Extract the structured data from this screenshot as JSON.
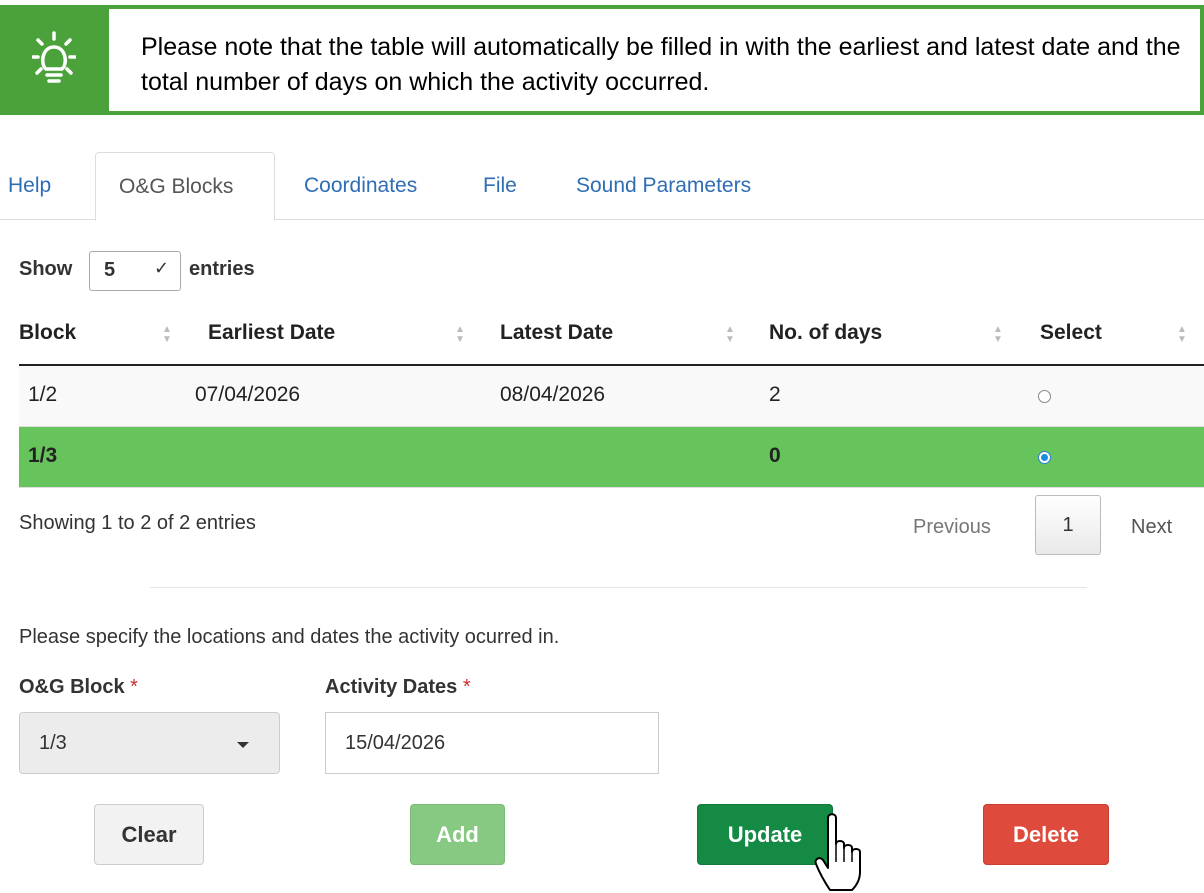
{
  "note": {
    "icon": "lightbulb-icon",
    "text": "Please note that the table will automatically be filled in with the earliest and latest date and the total number of days on which the activity occurred."
  },
  "tabs": [
    {
      "label": "Help",
      "active": false
    },
    {
      "label": "O&G Blocks",
      "active": true
    },
    {
      "label": "Coordinates",
      "active": false
    },
    {
      "label": "File",
      "active": false
    },
    {
      "label": "Sound Parameters",
      "active": false
    }
  ],
  "length": {
    "show_label": "Show",
    "value": "5",
    "entries_label": "entries"
  },
  "table": {
    "columns": [
      "Block",
      "Earliest Date",
      "Latest Date",
      "No. of days",
      "Select"
    ],
    "rows": [
      {
        "block": "1/2",
        "earliest": "07/04/2026",
        "latest": "08/04/2026",
        "days": "2",
        "selected": false
      },
      {
        "block": "1/3",
        "earliest": "",
        "latest": "",
        "days": "0",
        "selected": true
      }
    ]
  },
  "info": "Showing 1 to 2 of 2 entries",
  "pagination": {
    "previous": "Previous",
    "page": "1",
    "next": "Next"
  },
  "form": {
    "instruction": "Please specify the locations and dates the activity ocurred in.",
    "block_label": "O&G Block",
    "dates_label": "Activity Dates",
    "required_mark": "*",
    "block_value": "1/3",
    "dates_value": "15/04/2026"
  },
  "buttons": {
    "clear": "Clear",
    "add": "Add",
    "update": "Update",
    "delete": "Delete"
  },
  "colors": {
    "note_green": "#4ca23a",
    "selected_row": "#67c45d",
    "update": "#158a45",
    "add": "#87c882",
    "delete": "#de4a3b",
    "link": "#2f6db5"
  }
}
